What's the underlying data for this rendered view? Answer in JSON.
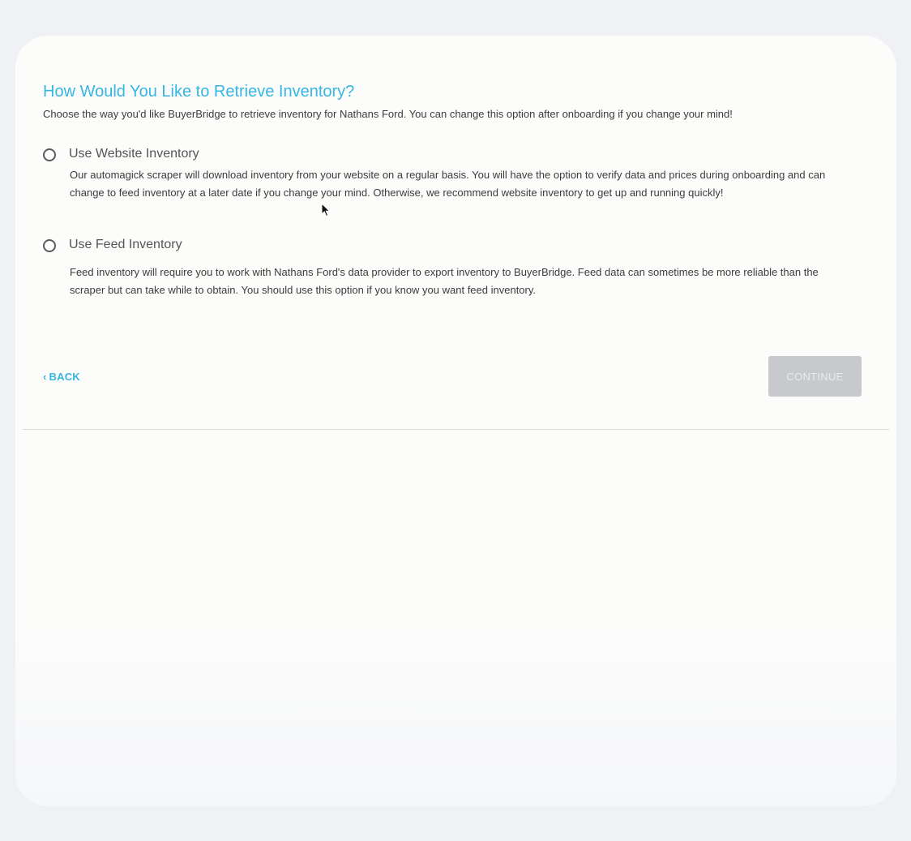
{
  "page": {
    "title": "How Would You Like to Retrieve Inventory?",
    "intro": "Choose the way you'd like BuyerBridge to retrieve inventory for Nathans Ford. You can change this option after onboarding if you change your mind!"
  },
  "options": [
    {
      "label": "Use Website Inventory",
      "description": "Our automagick scraper will download inventory from your website on a regular basis. You will have the option to verify data and prices during onboarding and can change to feed inventory at a later date if you change your mind. Otherwise, we recommend website inventory to get up and running quickly!",
      "selected": false
    },
    {
      "label": "Use Feed Inventory",
      "description": "Feed inventory will require you to work with Nathans Ford's data provider to export inventory to BuyerBridge. Feed data can sometimes be more reliable than the scraper but can take while to obtain. You should use this option if you know you want feed inventory.",
      "selected": false
    }
  ],
  "nav": {
    "back_label": "BACK",
    "back_icon": "chevron-left-icon",
    "continue_label": "CONTINUE",
    "continue_enabled": false
  },
  "colors": {
    "accent": "#36b6e3",
    "button_disabled_bg": "#c7c9cd",
    "button_disabled_text": "#e9eaec",
    "text": "#3c3c3c",
    "page_bg": "#f0f1f5"
  }
}
